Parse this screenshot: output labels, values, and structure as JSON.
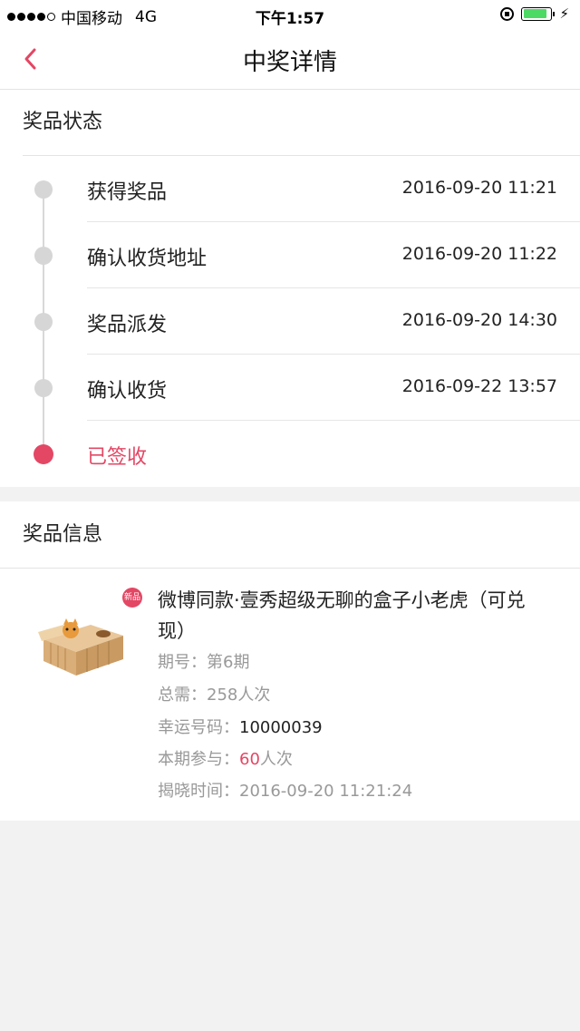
{
  "status_bar": {
    "carrier": "中国移动",
    "network": "4G",
    "time": "下午1:57",
    "signal_dots_filled": 4,
    "signal_dots_total": 5
  },
  "nav": {
    "title": "中奖详情",
    "back_icon": "chevron-left-icon"
  },
  "prize_status": {
    "header": "奖品状态",
    "steps": [
      {
        "label": "获得奖品",
        "time": "2016-09-20 11:21"
      },
      {
        "label": "确认收货地址",
        "time": "2016-09-20 11:22"
      },
      {
        "label": "奖品派发",
        "time": "2016-09-20 14:30"
      },
      {
        "label": "确认收货",
        "time": "2016-09-22 13:57"
      },
      {
        "label": "已签收",
        "time": ""
      }
    ]
  },
  "prize_info": {
    "header": "奖品信息",
    "badge": "新品",
    "title": "微博同款·壹秀超级无聊的盒子小老虎（可兑现）",
    "period_label": "期号：",
    "period_value": "第6期",
    "total_label": "总需：",
    "total_value": "258人次",
    "lucky_label": "幸运号码：",
    "lucky_value": "10000039",
    "participate_label": "本期参与：",
    "participate_count": "60",
    "participate_unit": "人次",
    "reveal_label": "揭晓时间：",
    "reveal_value": "2016-09-20 11:21:24"
  },
  "colors": {
    "accent": "#e34764",
    "timeline_dot": "#d6d6d6",
    "battery": "#4cd964"
  }
}
